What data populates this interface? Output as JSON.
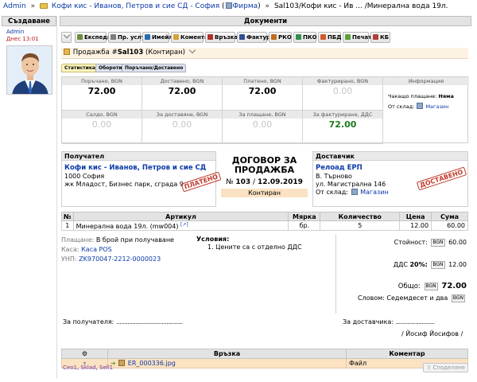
{
  "breadcrumb": {
    "user": "Admin",
    "company": "Кофи кис - Иванов, Петров и сие СД - София",
    "company_suffix": "Фирма",
    "document": "Sal103/Кофи кис - Ив ... /Минерална вода 19л."
  },
  "left_column": {
    "title": "Създаване",
    "author": "Admin",
    "created": "Днес 13:01"
  },
  "main_header": "Документи",
  "toolbar": {
    "buttons": [
      {
        "label": "Експедиране",
        "icon": "truck-icon",
        "color": "#6b8e3c"
      },
      {
        "label": "Пр. услуги",
        "icon": "services-icon",
        "color": "#7c7c7c"
      },
      {
        "label": "Имейл",
        "icon": "email-icon",
        "color": "#2b6cb0"
      },
      {
        "label": "Коментар",
        "icon": "comment-icon",
        "color": "#d6a23a"
      },
      {
        "label": "Връзка",
        "icon": "link-icon",
        "color": "#b0302b"
      },
      {
        "label": "Фактура",
        "icon": "invoice-icon",
        "color": "#2f4f8f"
      },
      {
        "label": "РКО",
        "icon": "cash-out-icon",
        "color": "#c46b1e"
      },
      {
        "label": "ПКО",
        "icon": "cash-in-icon",
        "color": "#2f8f4f"
      },
      {
        "label": "ПБД",
        "icon": "bank-icon",
        "color": "#d05b2e"
      },
      {
        "label": "Печат",
        "icon": "print-icon",
        "color": "#5a9e3a"
      },
      {
        "label": "КБ",
        "icon": "cashbox-icon",
        "color": "#b43c3c"
      }
    ]
  },
  "doc": {
    "prefix": "Продажба #",
    "number": "Sal103",
    "status": "(Контиран)"
  },
  "tabs": [
    "Статистика",
    "Обороти",
    "Поръчано/Доставено"
  ],
  "stats": {
    "ordered_label": "Поръчано, BGN",
    "ordered": "72.00",
    "delivered_label": "Доставено, BGN",
    "delivered": "72.00",
    "paid_label": "Платено, BGN",
    "paid": "72.00",
    "invoiced_label": "Фактурирано, BGN",
    "invoiced": "0.00",
    "balance_label": "Салдо, BGN",
    "balance": "0.00",
    "to_deliver_label": "За доставяне, BGN",
    "to_deliver": "0.00",
    "to_pay_label": "За плащане, BGN",
    "to_pay": "0.00",
    "to_invoice_label": "За фактуриране, ДДС",
    "to_invoice": "72.00"
  },
  "info": {
    "title": "Информация",
    "pending_label": "Чакащо плащане:",
    "pending_value": "Няма",
    "warehouse_label": "От склад:",
    "warehouse_value": "Магазин"
  },
  "recipient": {
    "title": "Получател",
    "name": "Кофи кис - Иванов, Петров и сие СД",
    "city": "1000 София",
    "address": "жк Младост, Бизнес парк, сграда 9",
    "stamp": "ПЛАТЕНО"
  },
  "contract": {
    "title_line1": "ДОГОВОР ЗА",
    "title_line2": "ПРОДАЖБА",
    "number_prefix": "№",
    "number": "103",
    "date": "12.09.2019",
    "status": "Контиран"
  },
  "supplier": {
    "title": "Доставчик",
    "name": "Релоад ЕРП",
    "city": "В. Търново",
    "address": "ул. Магистрална 146",
    "warehouse_label": "От склад:",
    "warehouse_value": "Магазин",
    "stamp": "ДОСТАВЕНО"
  },
  "items": {
    "headers": [
      "№",
      "Артикул",
      "Мярка",
      "Количество",
      "Цена",
      "Сума"
    ],
    "rows": [
      {
        "num": "1",
        "article": "Минерална вода 19л. (mw004)",
        "unit": "бр.",
        "qty": "5",
        "price": "12.00",
        "sum": "60.00"
      }
    ]
  },
  "payment": {
    "method_label": "Плащане:",
    "method": "В брой при получаване",
    "cash_label": "Каса:",
    "cash": "Каса POS",
    "unp_label": "УНП:",
    "unp": "ZK970047-2212-0000023"
  },
  "conditions": {
    "title": "Условия:",
    "items": [
      "1. Цените са с отделно ДДС"
    ]
  },
  "totals": {
    "value_label": "Стойност:",
    "currency": "BGN",
    "value": "60.00",
    "vat_label": "ДДС",
    "vat_rate": "20%:",
    "vat": "12.00",
    "total_label": "Общо:",
    "total": "72.00",
    "words_label": "Словом:",
    "words": "Седемдесет и два"
  },
  "signatures": {
    "receiver_label": "За получателя:",
    "supplier_label": "За доставчика:",
    "supplier_name": "/ Йосиф Йосифов /"
  },
  "attachments": {
    "headers": [
      "Връзка",
      "Коментар"
    ],
    "rows": [
      {
        "file": "ER_000336.jpg",
        "comment": "Файл"
      }
    ]
  },
  "footer_links": [
    "Ceo1",
    "Sklad",
    "Sell1"
  ],
  "share_label": "Споделяне"
}
